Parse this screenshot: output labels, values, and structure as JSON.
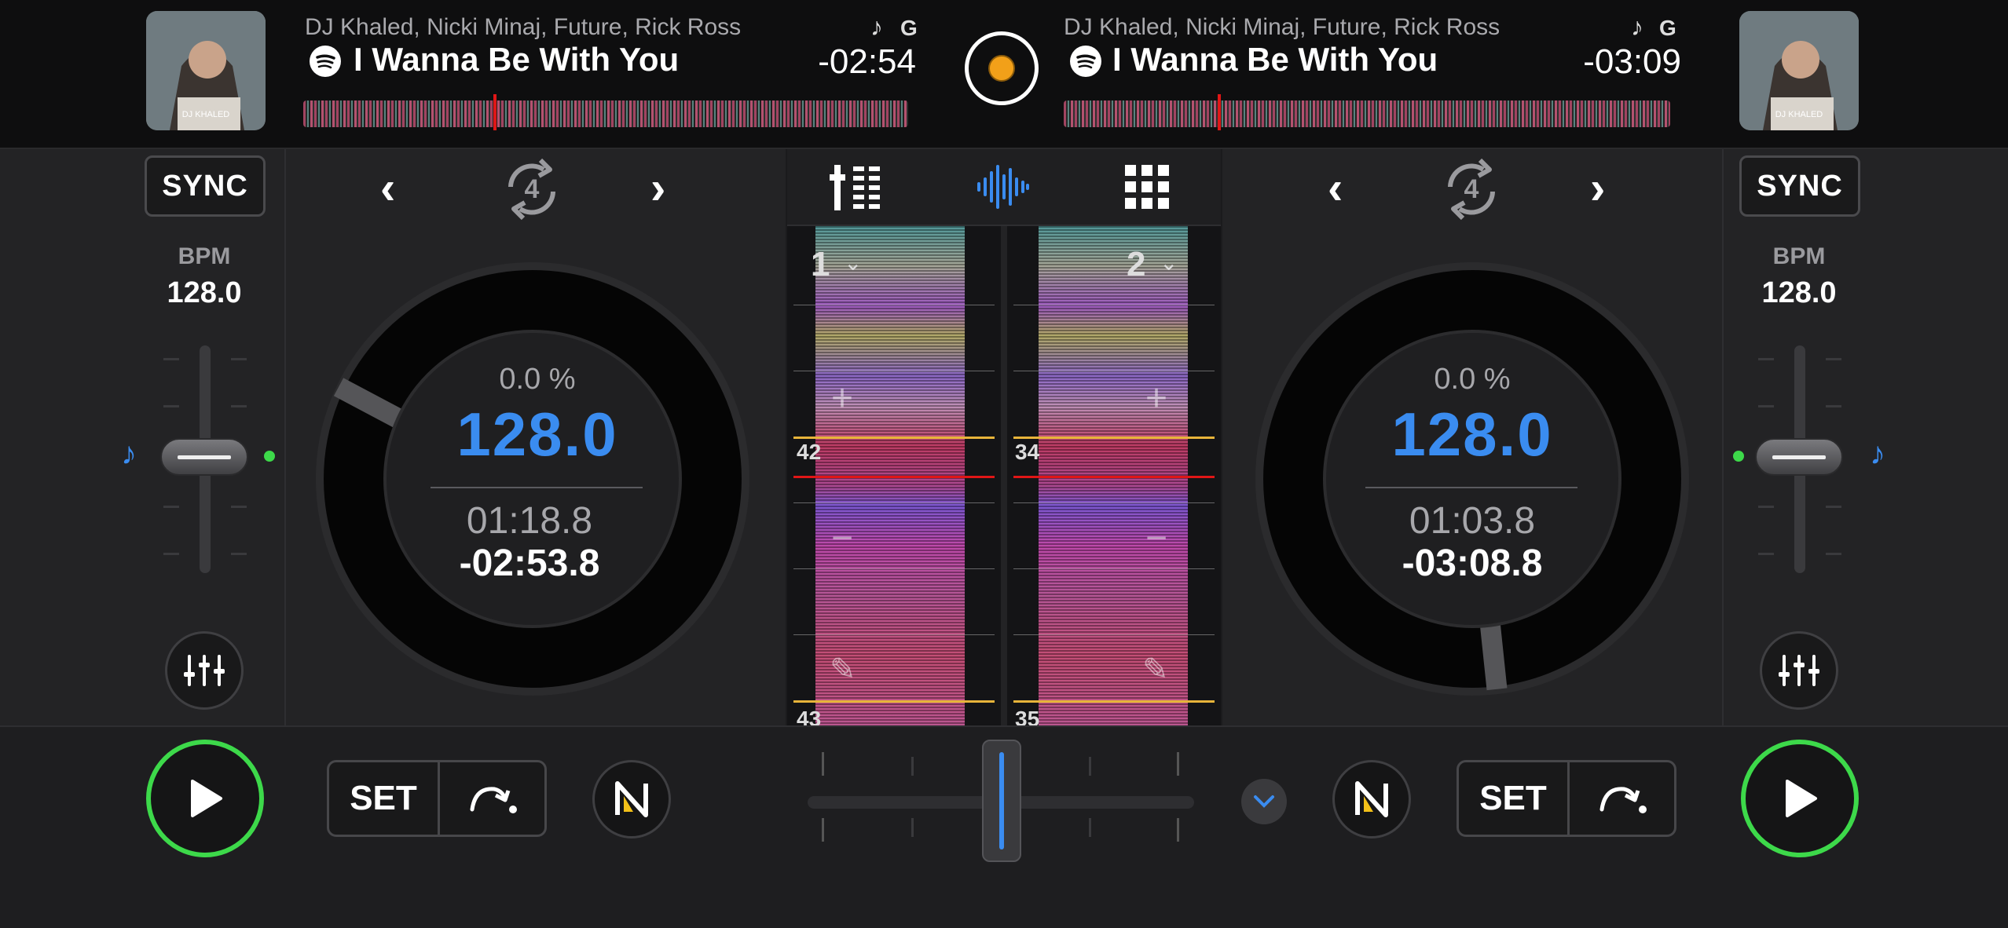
{
  "deck_left": {
    "artist": "DJ Khaled, Nicki Minaj, Future, Rick Ross",
    "title": "I Wanna Be With You",
    "key": "G",
    "remaining_top": "-02:54",
    "sync_label": "SYNC",
    "bpm_label": "BPM",
    "bpm": "128.0",
    "pitch_pct": "0.0 %",
    "tempo": "128.0",
    "elapsed": "01:18.8",
    "remaining": "-02:53.8",
    "loop_size": "4",
    "set_label": "SET",
    "deck_number": "1",
    "beat_number_a": "42",
    "beat_number_b": "43",
    "album_caption": "DJ KHALED"
  },
  "deck_right": {
    "artist": "DJ Khaled, Nicki Minaj, Future, Rick Ross",
    "title": "I Wanna Be With You",
    "key": "G",
    "remaining_top": "-03:09",
    "sync_label": "SYNC",
    "bpm_label": "BPM",
    "bpm": "128.0",
    "pitch_pct": "0.0 %",
    "tempo": "128.0",
    "elapsed": "01:03.8",
    "remaining": "-03:08.8",
    "loop_size": "4",
    "set_label": "SET",
    "deck_number": "2",
    "beat_number_a": "34",
    "beat_number_b": "35",
    "album_caption": "DJ KHALED"
  },
  "colors": {
    "accent_blue": "#3a8cf0",
    "play_green": "#3dd94a",
    "playhead_red": "#e01616",
    "beat_yellow": "#e7b43a"
  },
  "icons": {
    "mixer_view": "mixer-bars-icon",
    "waveform_view": "waveform-icon",
    "pads_view": "grid-pads-icon",
    "record": "record-icon"
  }
}
